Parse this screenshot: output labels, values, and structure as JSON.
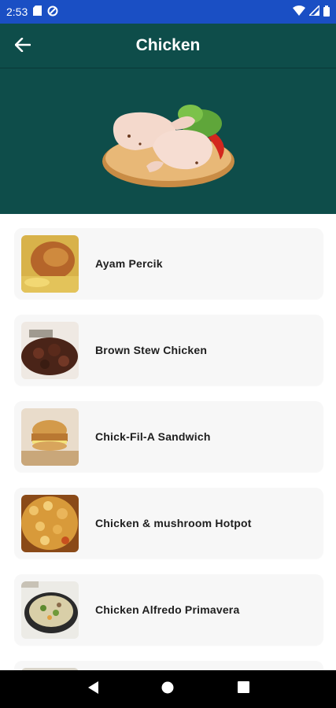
{
  "status_bar": {
    "time": "2:53",
    "icons": [
      "sd-card-icon",
      "data-saver-icon",
      "wifi-icon",
      "signal-icon",
      "battery-icon"
    ]
  },
  "app_bar": {
    "title": "Chicken",
    "back_icon": "arrow-back-icon"
  },
  "colors": {
    "status_bar": "#1a4fc4",
    "app_bar": "#0e4d4a",
    "card_background": "#f7f7f7",
    "nav_bar": "#000000"
  },
  "meals": [
    {
      "name": "Ayam Percik",
      "thumbnail": "ayam-percik-thumbnail"
    },
    {
      "name": "Brown Stew Chicken",
      "thumbnail": "brown-stew-chicken-thumbnail"
    },
    {
      "name": "Chick-Fil-A Sandwich",
      "thumbnail": "chick-fil-a-sandwich-thumbnail"
    },
    {
      "name": "Chicken & mushroom Hotpot",
      "thumbnail": "chicken-mushroom-hotpot-thumbnail"
    },
    {
      "name": "Chicken Alfredo Primavera",
      "thumbnail": "chicken-alfredo-primavera-thumbnail"
    }
  ],
  "nav_bar": {
    "icons": [
      "back-triangle-icon",
      "home-circle-icon",
      "recents-square-icon"
    ]
  }
}
